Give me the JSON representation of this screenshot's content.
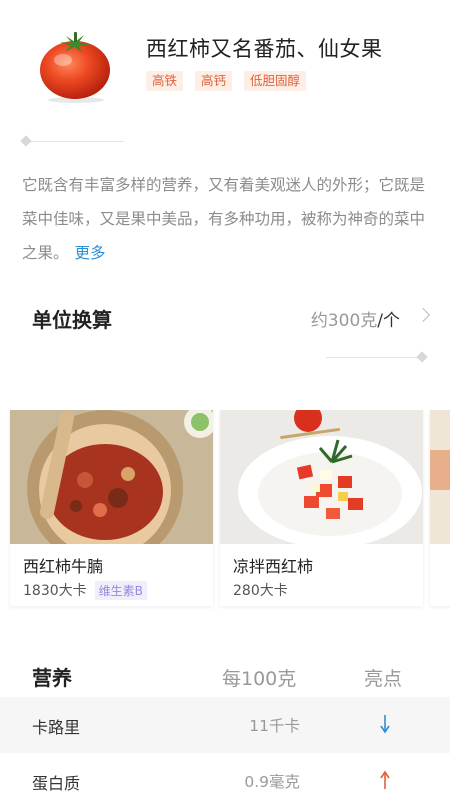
{
  "header": {
    "title": "西红柿又名番茄、仙女果",
    "tags": [
      "高铁",
      "高钙",
      "低胆固醇"
    ]
  },
  "description": {
    "text": "它既含有丰富多样的营养，又有着美观迷人的外形；它既是菜中佳味，又是果中美品，有多种功用，被称为神奇的菜中之果。",
    "more_label": "更多"
  },
  "unit": {
    "label": "单位换算",
    "value": "约300克",
    "suffix": "/个"
  },
  "recipes": [
    {
      "name": "西红柿牛腩",
      "kcal": "1830大卡",
      "badge": "维生素B"
    },
    {
      "name": "凉拌西红柿",
      "kcal": "280大卡",
      "badge": ""
    }
  ],
  "nutrition": {
    "title": "营养",
    "per_label": "每100克",
    "highlight_label": "亮点",
    "rows": [
      {
        "name": "卡路里",
        "value": "11千卡",
        "trend": "down",
        "color": "#2d8fd5"
      },
      {
        "name": "蛋白质",
        "value": "0.9毫克",
        "trend": "up",
        "color": "#e0613c"
      }
    ]
  },
  "colors": {
    "accent_blue": "#2d8fd5",
    "tag_orange": "#e0613c",
    "badge_purple": "#9c88d9"
  }
}
